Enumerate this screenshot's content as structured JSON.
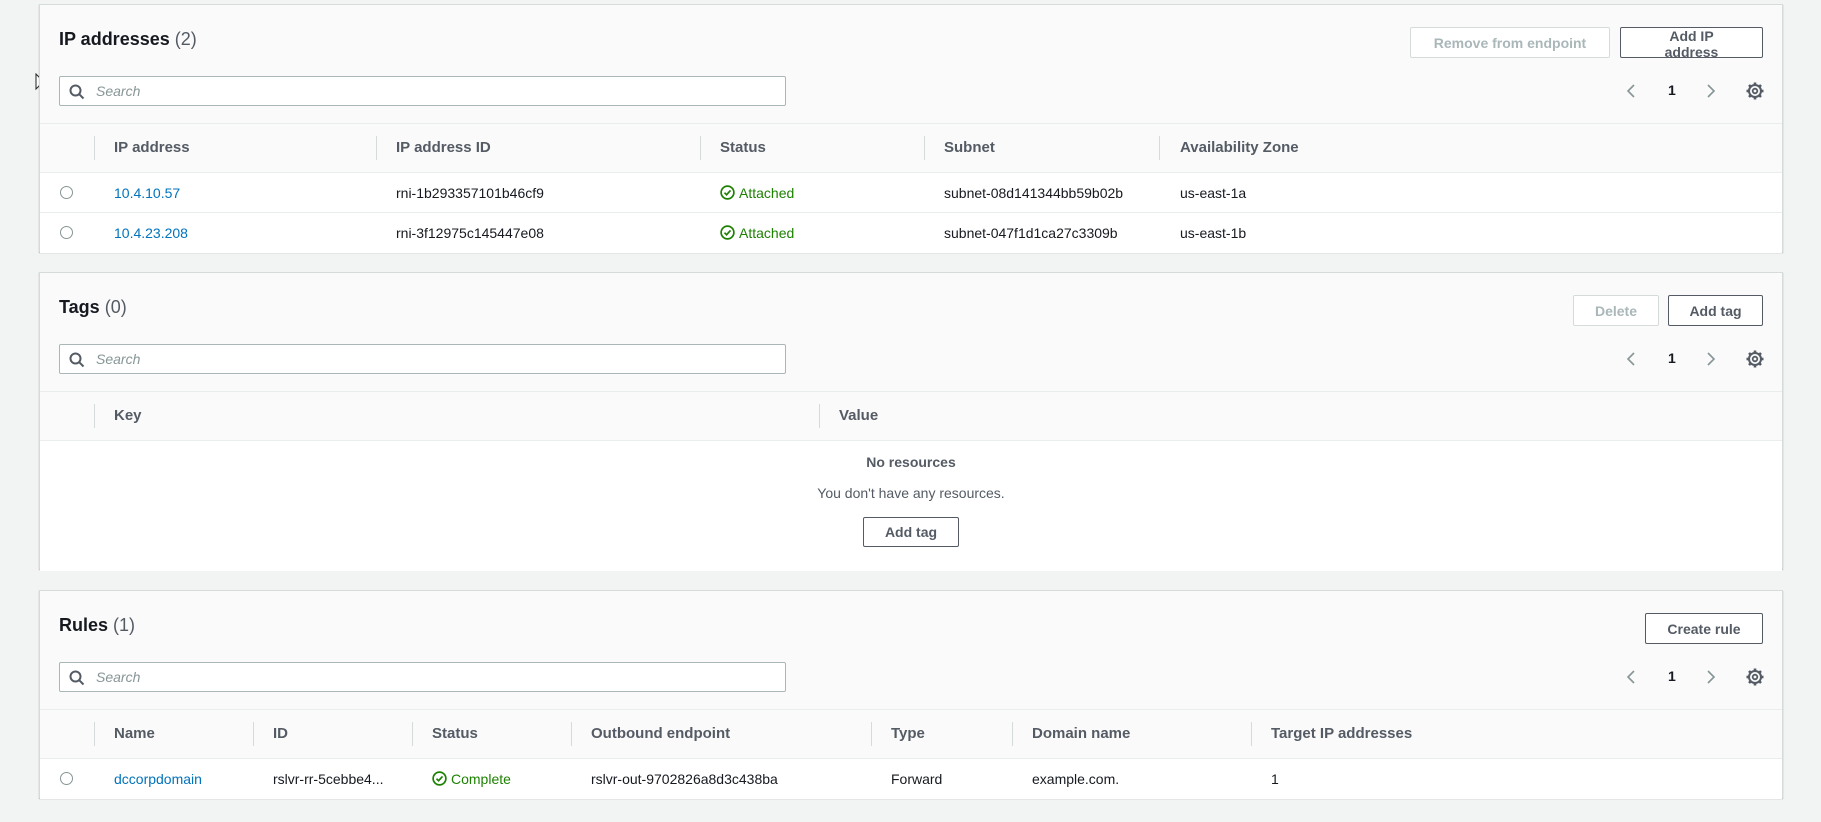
{
  "ip_section": {
    "title": "IP addresses",
    "count": "(2)",
    "remove_label": "Remove from endpoint",
    "add_label": "Add IP address",
    "search_placeholder": "Search",
    "page": "1",
    "columns": [
      "IP address",
      "IP address ID",
      "Status",
      "Subnet",
      "Availability Zone"
    ],
    "rows": [
      {
        "ip": "10.4.10.57",
        "id": "rni-1b293357101b46cf9",
        "status": "Attached",
        "subnet": "subnet-08d141344bb59b02b",
        "az": "us-east-1a"
      },
      {
        "ip": "10.4.23.208",
        "id": "rni-3f12975c145447e08",
        "status": "Attached",
        "subnet": "subnet-047f1d1ca27c3309b",
        "az": "us-east-1b"
      }
    ]
  },
  "tags_section": {
    "title": "Tags",
    "count": "(0)",
    "delete_label": "Delete",
    "add_label": "Add tag",
    "search_placeholder": "Search",
    "page": "1",
    "columns": [
      "Key",
      "Value"
    ],
    "empty_title": "No resources",
    "empty_text": "You don't have any resources.",
    "empty_button": "Add tag"
  },
  "rules_section": {
    "title": "Rules",
    "count": "(1)",
    "create_label": "Create rule",
    "search_placeholder": "Search",
    "page": "1",
    "columns": [
      "Name",
      "ID",
      "Status",
      "Outbound endpoint",
      "Type",
      "Domain name",
      "Target IP addresses"
    ],
    "rows": [
      {
        "name": "dccorpdomain",
        "id": "rslvr-rr-5cebbe4...",
        "status": "Complete",
        "endpoint": "rslvr-out-9702826a8d3c438ba",
        "type": "Forward",
        "domain": "example.com.",
        "targets": "1"
      }
    ]
  },
  "colors": {
    "link": "#0073bb",
    "success": "#1d8102",
    "background": "#f2f3f3"
  },
  "icons": [
    "search-icon",
    "chevron-left-icon",
    "chevron-right-icon",
    "gear-icon",
    "check-circle-icon",
    "mouse-cursor-icon"
  ]
}
